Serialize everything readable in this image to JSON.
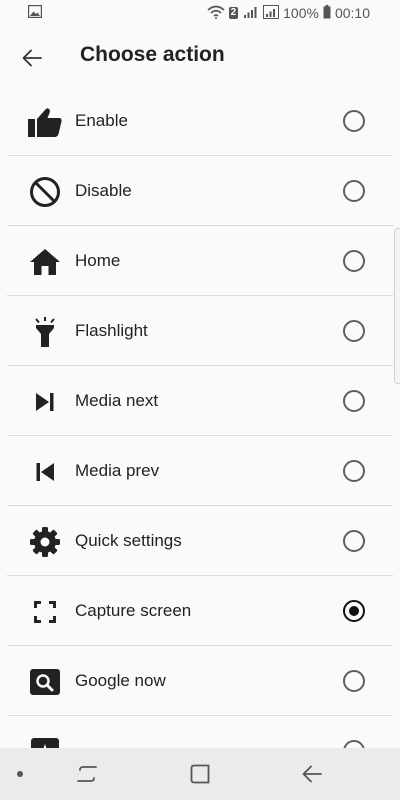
{
  "status_bar": {
    "sim_slot": "2",
    "battery": "100%",
    "time": "00:10"
  },
  "toolbar": {
    "title": "Choose action"
  },
  "actions": [
    {
      "label": "Enable",
      "icon": "thumbs-up-icon",
      "selected": false
    },
    {
      "label": "Disable",
      "icon": "block-icon",
      "selected": false
    },
    {
      "label": "Home",
      "icon": "home-icon",
      "selected": false
    },
    {
      "label": "Flashlight",
      "icon": "flashlight-icon",
      "selected": false
    },
    {
      "label": "Media next",
      "icon": "skip-next-icon",
      "selected": false
    },
    {
      "label": "Media prev",
      "icon": "skip-previous-icon",
      "selected": false
    },
    {
      "label": "Quick settings",
      "icon": "gear-icon",
      "selected": false
    },
    {
      "label": "Capture screen",
      "icon": "capture-screen-icon",
      "selected": true
    },
    {
      "label": "Google now",
      "icon": "search-icon",
      "selected": false
    },
    {
      "label": "",
      "icon": "assistant-icon",
      "selected": false
    }
  ],
  "colors": {
    "background": "#fafafa",
    "text": "#222222",
    "icon": "#222222",
    "divider": "#dcdcdc",
    "nav_bar": "#ebebeb"
  }
}
